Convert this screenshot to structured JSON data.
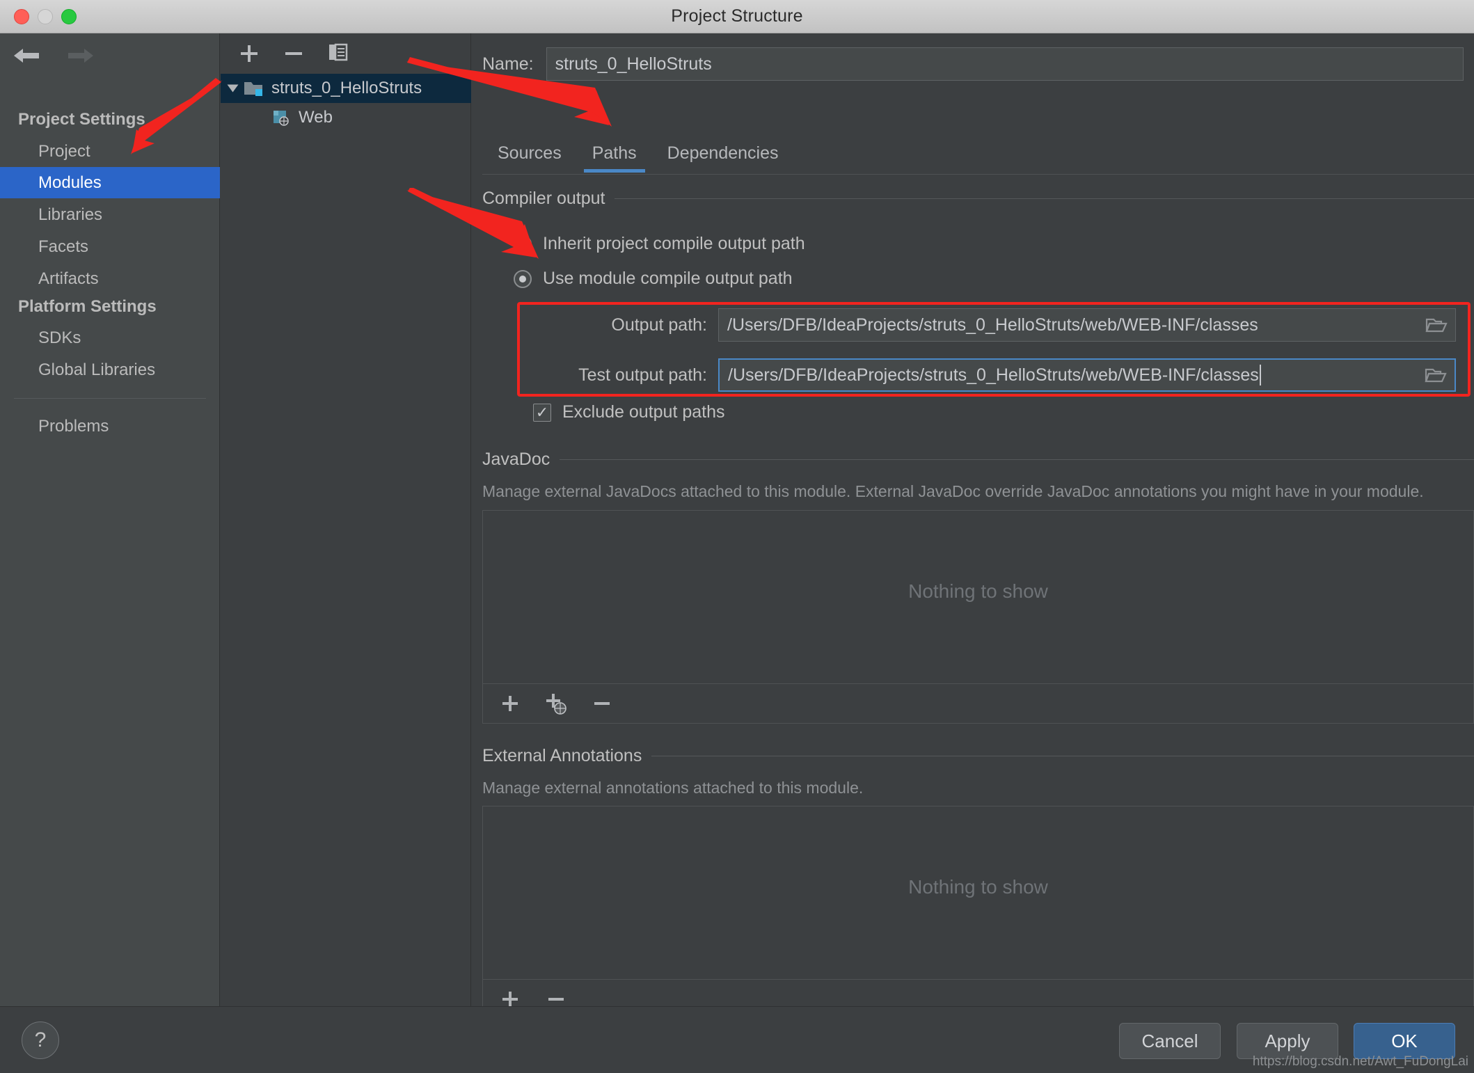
{
  "window": {
    "title": "Project Structure",
    "traffic_lights": [
      "close-red",
      "minimize-yellow",
      "zoom-green"
    ]
  },
  "sidebar": {
    "back_icon": "back-arrow-icon",
    "forward_icon": "forward-arrow-icon",
    "groups": [
      {
        "title": "Project Settings",
        "items": [
          {
            "label": "Project",
            "selected": false
          },
          {
            "label": "Modules",
            "selected": true
          },
          {
            "label": "Libraries",
            "selected": false
          },
          {
            "label": "Facets",
            "selected": false
          },
          {
            "label": "Artifacts",
            "selected": false
          }
        ]
      },
      {
        "title": "Platform Settings",
        "items": [
          {
            "label": "SDKs",
            "selected": false
          },
          {
            "label": "Global Libraries",
            "selected": false
          }
        ]
      }
    ],
    "extra_items": [
      {
        "label": "Problems",
        "selected": false
      }
    ]
  },
  "tree_panel": {
    "toolbar": [
      {
        "name": "add-module-button",
        "icon": "plus-icon"
      },
      {
        "name": "remove-module-button",
        "icon": "minus-icon"
      },
      {
        "name": "copy-module-button",
        "icon": "copy-icon"
      }
    ],
    "nodes": [
      {
        "label": "struts_0_HelloStruts",
        "icon": "module-folder-icon",
        "selected": true,
        "expanded": true,
        "depth": 0
      },
      {
        "label": "Web",
        "icon": "web-facet-icon",
        "selected": false,
        "depth": 1
      }
    ]
  },
  "main": {
    "name_label": "Name:",
    "name_value": "struts_0_HelloStruts",
    "tabs": [
      {
        "label": "Sources",
        "active": false
      },
      {
        "label": "Paths",
        "active": true
      },
      {
        "label": "Dependencies",
        "active": false
      }
    ],
    "compiler_output": {
      "section_title": "Compiler output",
      "options": [
        {
          "label": "Inherit project compile output path",
          "selected": false
        },
        {
          "label": "Use module compile output path",
          "selected": true
        }
      ],
      "output_path": {
        "label": "Output path:",
        "value": "/Users/DFB/IdeaProjects/struts_0_HelloStruts/web/WEB-INF/classes",
        "focused": false,
        "browse_icon": "folder-icon"
      },
      "test_output_path": {
        "label": "Test output path:",
        "value": "/Users/DFB/IdeaProjects/struts_0_HelloStruts/web/WEB-INF/classes",
        "focused": true,
        "browse_icon": "folder-icon"
      },
      "exclude_checkbox": {
        "label": "Exclude output paths",
        "checked": true,
        "mark": "✓"
      }
    },
    "javadoc": {
      "section_title": "JavaDoc",
      "description": "Manage external JavaDocs attached to this module. External JavaDoc override JavaDoc annotations you might have in your module.",
      "empty_text": "Nothing to show",
      "toolbar": [
        {
          "name": "add-javadoc-path-button",
          "icon": "plus-icon"
        },
        {
          "name": "add-javadoc-url-button",
          "icon": "plus-globe-icon"
        },
        {
          "name": "remove-javadoc-button",
          "icon": "minus-icon"
        }
      ]
    },
    "external_annotations": {
      "section_title": "External Annotations",
      "description": "Manage external annotations attached to this module.",
      "empty_text": "Nothing to show",
      "toolbar": [
        {
          "name": "add-annotation-button",
          "icon": "plus-icon"
        },
        {
          "name": "remove-annotation-button",
          "icon": "minus-icon"
        }
      ]
    }
  },
  "footer": {
    "help_label": "?",
    "buttons": [
      {
        "label": "Cancel",
        "primary": false
      },
      {
        "label": "Apply",
        "primary": false
      },
      {
        "label": "OK",
        "primary": true
      }
    ],
    "watermark": "https://blog.csdn.net/Awt_FuDongLai"
  },
  "colors": {
    "accent_blue": "#2b65c8",
    "tab_underline": "#4a88c7",
    "annotation_red": "#f2241f",
    "panel_bg": "#3c3f41",
    "sidebar_bg": "#45494a",
    "tree_selected": "#0d293e",
    "ok_button": "#37618e"
  }
}
